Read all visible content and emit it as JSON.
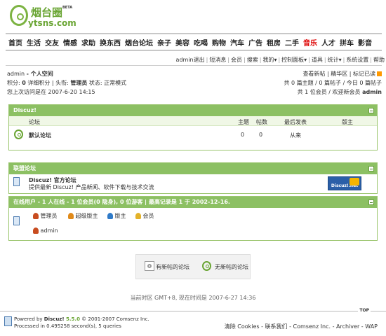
{
  "logo": {
    "cn": "烟台圈",
    "beta": "BETA",
    "en": "ytsns.com"
  },
  "mainnav": [
    "首页",
    "生活",
    "交友",
    "情感",
    "求助",
    "换东西",
    "烟台论坛",
    "亲子",
    "美容",
    "吃喝",
    "购物",
    "汽车",
    "广告",
    "租房",
    "二手",
    "音乐",
    "人才",
    "拼车",
    "影音"
  ],
  "mainnav_highlight_index": 15,
  "usernav": [
    "admin",
    "退出",
    "短消息",
    "会员",
    "搜索",
    "我的",
    "控制面板",
    "道具",
    "统计",
    "系统设置",
    "帮助"
  ],
  "user": {
    "name": "admin",
    "space": "- 个人空间",
    "line2_a": "积分: ",
    "credits": "0",
    "line2_b": " 详细积分 | 头衔: ",
    "title": "管理员",
    "line2_c": " 状态: 正常模式",
    "lastvisit": "您上次访问是在 2007-6-20 14:15"
  },
  "right": {
    "line1": "查看新帖 | 精华区 | 标记已读",
    "line2": "共 0 篇主题 / 0 篇帖子 / 今日 0 篇帖子",
    "line3_a": "共 1 位会员 / 欢迎新会员 ",
    "newmember": "admin"
  },
  "forum_box": {
    "title": "Discuz!",
    "columns": [
      "论坛",
      "主题",
      "帖数",
      "最后发表",
      "版主"
    ],
    "rows": [
      {
        "name": "默认论坛",
        "topics": "0",
        "posts": "0",
        "last": "从来",
        "mods": ""
      }
    ]
  },
  "league_box": {
    "title": "联盟论坛",
    "name": "Discuz! 官方论坛",
    "desc": "提供最新 Discuz! 产品新闻、软件下载与技术交流",
    "badge": "Discuz!.net"
  },
  "online_box": {
    "title": "在线用户 - 1 人在线 - 1 位会员(0 隐身), 0 位游客 | 最高记录是 1 于 2002-12-16.",
    "legend": [
      "管理员",
      "超级版主",
      "版主",
      "会员"
    ],
    "users": [
      "admin"
    ]
  },
  "legend": {
    "new": "有新帖的论坛",
    "nonew": "无新帖的论坛"
  },
  "timezone": "当前时区 GMT+8, 现在时间是 2007-6-27 14:36",
  "footer": {
    "powered": "Powered by ",
    "brand": "Discuz!",
    "version": " 5.5.0",
    "copy": " © 2001-2007 Comsenz Inc.",
    "processed": "Processed in 0.495258 second(s), 5 queries",
    "top": "TOP",
    "links": "清除 Cookies - 联系我们 - Comsenz Inc. - Archiver - WAP"
  },
  "colors": {
    "accent": "#8cc063",
    "logo": "#6aa534",
    "highlight": "#dd0000"
  }
}
